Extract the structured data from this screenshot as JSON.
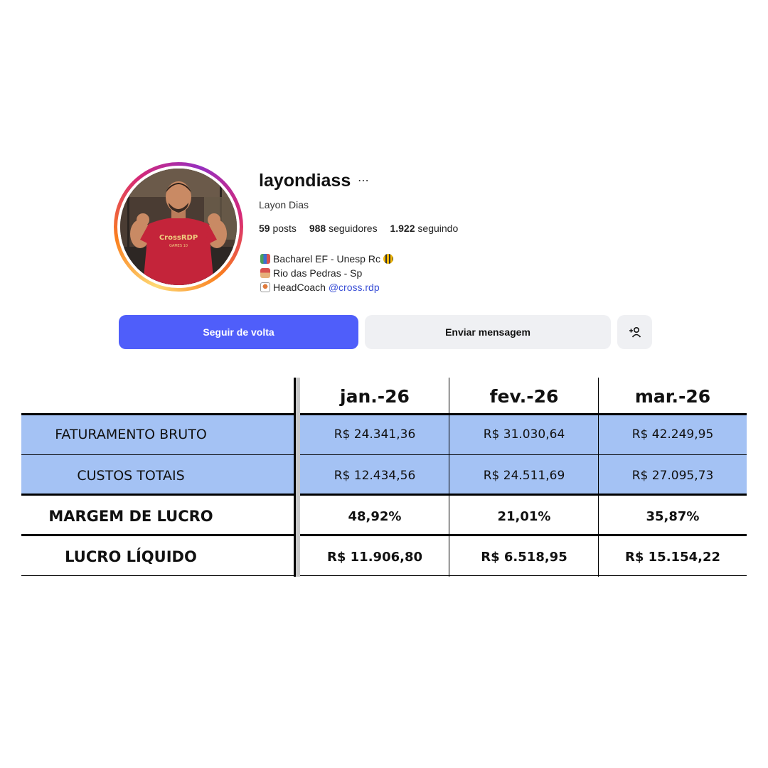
{
  "profile": {
    "username": "layondiass",
    "full_name": "Layon Dias",
    "more_icon": "ellipsis-icon",
    "stats": {
      "posts_count": "59",
      "posts_label": "posts",
      "followers_count": "988",
      "followers_label": "seguidores",
      "following_count": "1.922",
      "following_label": "seguindo"
    },
    "bio": [
      {
        "icon": "books-icon",
        "text": "Bacharel EF - Unesp Rc",
        "trail_icon": "bee-icon"
      },
      {
        "icon": "house-icon",
        "text": "Rio das Pedras - Sp"
      },
      {
        "icon": "weightlifter-icon",
        "text": "HeadCoach ",
        "mention": "@cross.rdp"
      }
    ],
    "avatar_shirt_text": "CrossRDP",
    "avatar_shirt_subtext": "GAMES 10"
  },
  "actions": {
    "follow_back_label": "Seguir de volta",
    "message_label": "Enviar mensagem",
    "add_person_icon": "add-person-icon"
  },
  "colors": {
    "primary_button": "#4f5efa",
    "secondary_button": "#eff0f3",
    "table_highlight": "#a4c2f4",
    "mention": "#3a4fd6"
  },
  "table": {
    "columns": [
      "jan.-26",
      "fev.-26",
      "mar.-26"
    ],
    "rows": [
      {
        "label": "FATURAMENTO BRUTO",
        "values": [
          "R$ 24.341,36",
          "R$ 31.030,64",
          "R$ 42.249,95"
        ]
      },
      {
        "label": "CUSTOS TOTAIS",
        "values": [
          "R$ 12.434,56",
          "R$ 24.511,69",
          "R$ 27.095,73"
        ]
      },
      {
        "label": "MARGEM DE LUCRO",
        "values": [
          "48,92%",
          "21,01%",
          "35,87%"
        ]
      },
      {
        "label": "LUCRO LÍQUIDO",
        "values": [
          "R$ 11.906,80",
          "R$ 6.518,95",
          "R$ 15.154,22"
        ]
      }
    ]
  }
}
